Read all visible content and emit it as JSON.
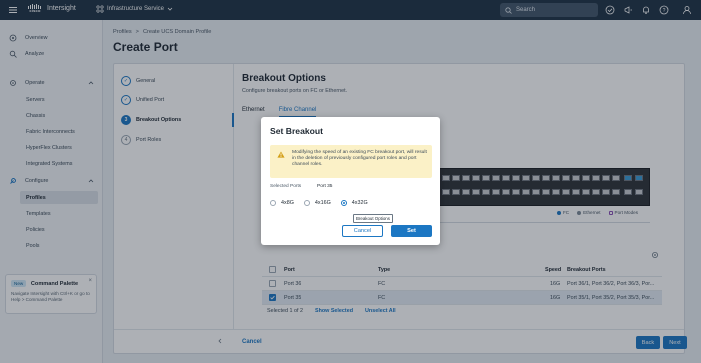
{
  "topbar": {
    "brand_top": "cisco",
    "brand": "Intersight",
    "service": "Infrastructure Service",
    "search_placeholder": "Search"
  },
  "nav": {
    "overview": "Overview",
    "analyze": "Analyze",
    "operate": "Operate",
    "operate_items": [
      "Servers",
      "Chassis",
      "Fabric Interconnects",
      "HyperFlex Clusters",
      "Integrated Systems"
    ],
    "configure": "Configure",
    "configure_items": [
      "Profiles",
      "Templates",
      "Policies",
      "Pools"
    ]
  },
  "palette": {
    "tag": "New",
    "title": "Command Palette",
    "desc": "Navigate Intersight with Ctrl+K or go to Help > Command Palette"
  },
  "breadcrumb": [
    "Profiles",
    ">",
    "Create UCS Domain Profile"
  ],
  "page_title": "Create Port",
  "steps": [
    {
      "num": "✓",
      "label": "General"
    },
    {
      "num": "✓",
      "label": "Unified Port"
    },
    {
      "num": "3",
      "label": "Breakout Options"
    },
    {
      "num": "4",
      "label": "Port Roles"
    }
  ],
  "section": {
    "title": "Breakout Options",
    "subtitle": "Configure breakout ports on FC or Ethernet."
  },
  "tabs": [
    "Ethernet",
    "Fibre Channel"
  ],
  "legend": [
    "FC",
    "Ethernet",
    "Port Modes"
  ],
  "table": {
    "headers": [
      "Port",
      "Type",
      "Speed",
      "Breakout Ports"
    ],
    "rows": [
      {
        "port": "Port 36",
        "type": "FC",
        "speed": "16G",
        "breakout": "Port 36/1, Port 36/2, Port 36/3, Por..."
      },
      {
        "port": "Port 35",
        "type": "FC",
        "speed": "16G",
        "breakout": "Port 35/1, Port 35/2, Port 35/3, Por..."
      }
    ],
    "selected_info": "Selected 1 of 2",
    "show_selected": "Show Selected",
    "unselect_all": "Unselect All"
  },
  "footer": {
    "cancel": "Cancel",
    "back": "Back",
    "next": "Next"
  },
  "modal": {
    "title": "Set Breakout",
    "warning": "Modifying the speed of an existing FC breakout port, will result in the deletion of previously configured port roles and port channel roles.",
    "selected_ports_label": "Selected Ports",
    "selected_ports_value": "Port 35",
    "options": [
      "4x8G",
      "4x16G",
      "4x32G"
    ],
    "selected_option": "4x32G",
    "tooltip": "Breakout Options",
    "cancel": "Cancel",
    "set": "Set"
  },
  "colors": {
    "topbar": "#1f3345",
    "accent": "#1c77c3",
    "warning_bg": "#fbf1c7"
  }
}
